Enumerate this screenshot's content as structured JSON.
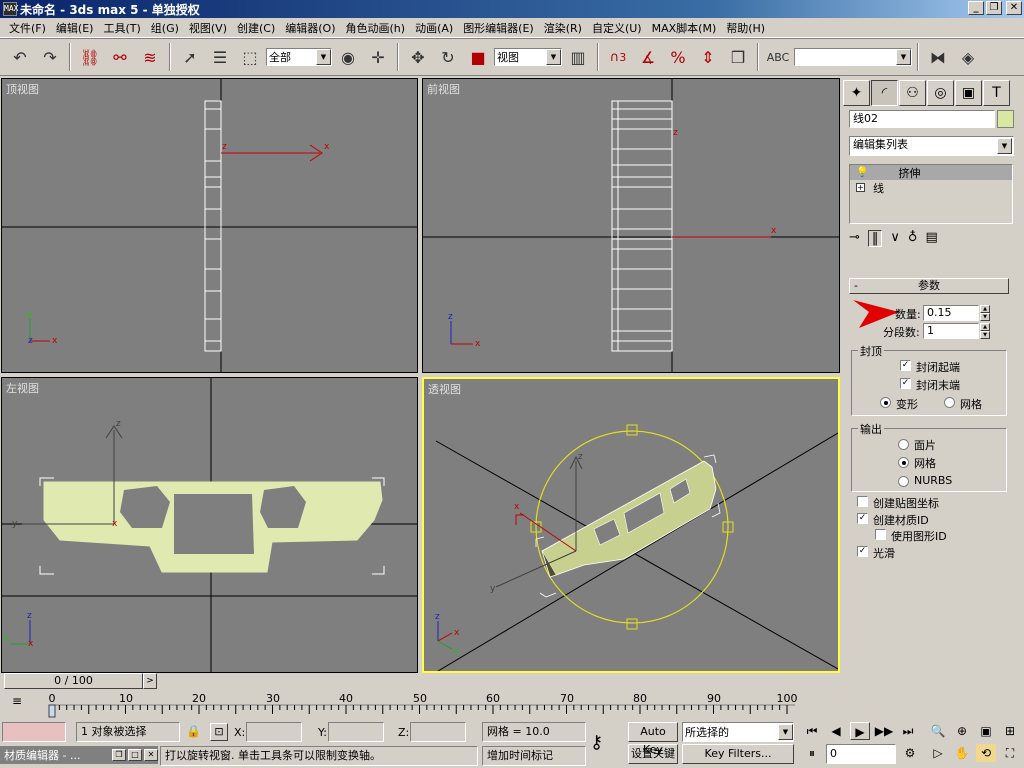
{
  "window": {
    "title": "未命名 - 3ds max 5 - 单独授权",
    "app_icon_text": "MAX"
  },
  "menu": [
    "文件(F)",
    "编辑(E)",
    "工具(T)",
    "组(G)",
    "视图(V)",
    "创建(C)",
    "编辑器(O)",
    "角色动画(h)",
    "动画(A)",
    "图形编辑器(E)",
    "渲染(R)",
    "自定义(U)",
    "MAX脚本(M)",
    "帮助(H)"
  ],
  "toolbar": {
    "selection_filter": "全部",
    "ref_coord": "视图",
    "named_selection": "",
    "percent_snap_label": "%",
    "angle_snap_label": "3"
  },
  "viewports": {
    "top": "顶视图",
    "front": "前视图",
    "left": "左视图",
    "perspective": "透视图"
  },
  "axis": {
    "x": "x",
    "y": "y",
    "z": "z"
  },
  "command_panel": {
    "object_name": "线02",
    "object_color": "#d8e8a0",
    "modifier_list": "编辑集列表",
    "stack": [
      "挤伸",
      "线"
    ],
    "rollout_title": "参数",
    "amount_label": "数量:",
    "amount_value": "0.15",
    "segments_label": "分段数:",
    "segments_value": "1",
    "capping": {
      "title": "封顶",
      "cap_start": "封闭起端",
      "cap_end": "封闭末端",
      "morph": "变形",
      "grid": "网格"
    },
    "output": {
      "title": "输出",
      "patch": "面片",
      "mesh": "网格",
      "nurbs": "NURBS"
    },
    "gen_mapping": "创建贴图坐标",
    "gen_mat_ids": "创建材质ID",
    "use_shape_ids": "使用图形ID",
    "smooth": "光滑"
  },
  "timeline": {
    "frame_display": "0 / 100",
    "ticks": [
      "0",
      "10",
      "20",
      "30",
      "40",
      "50",
      "60",
      "70",
      "80",
      "90",
      "100"
    ]
  },
  "status": {
    "selection": "1 对象被选择",
    "x_label": "X:",
    "y_label": "Y:",
    "z_label": "Z:",
    "grid": "网格 = 10.0",
    "prompt": "打以旋转视窗. 单击工具条可以限制变换轴。",
    "add_time_tag": "增加时间标记",
    "auto_key": "Auto Key",
    "set_key": "设置关键帧",
    "key_mode": "所选择的",
    "key_filters": "Key Filters...",
    "current_frame": "0"
  },
  "taskbar": {
    "material_editor": "材质编辑器 - ..."
  }
}
